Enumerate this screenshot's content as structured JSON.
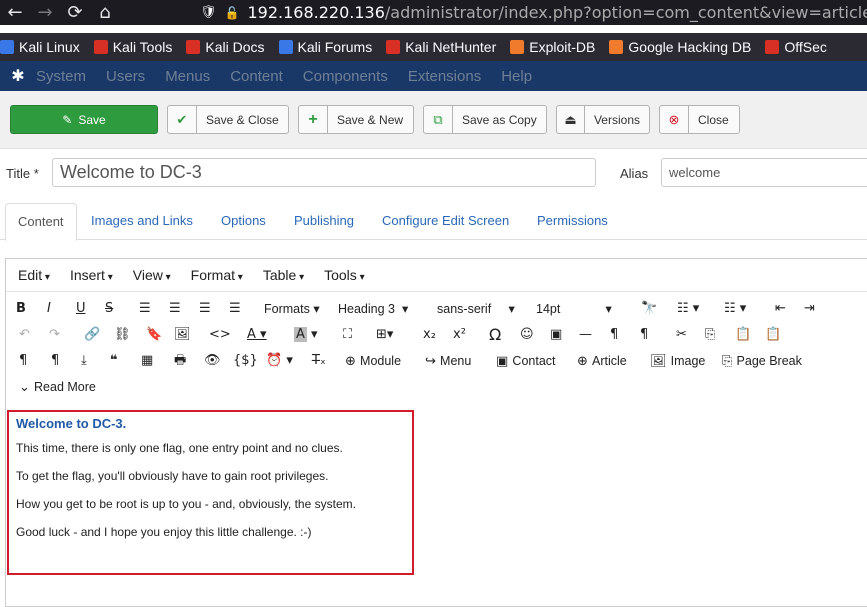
{
  "browser": {
    "nav": [
      "←",
      "→",
      "⟳",
      "⌂"
    ],
    "url_host": "192.168.220.136",
    "url_path": "/administrator/index.php?option=com_content&view=article&return=fe"
  },
  "bookmarks": [
    {
      "label": "Kali Linux",
      "color": "#3b78e7"
    },
    {
      "label": "Kali Tools",
      "color": "#d93025"
    },
    {
      "label": "Kali Docs",
      "color": "#d93025"
    },
    {
      "label": "Kali Forums",
      "color": "#3b78e7"
    },
    {
      "label": "Kali NetHunter",
      "color": "#d93025"
    },
    {
      "label": "Exploit-DB",
      "color": "#f07b2c"
    },
    {
      "label": "Google Hacking DB",
      "color": "#f07b2c"
    },
    {
      "label": "OffSec",
      "color": "#d93025"
    }
  ],
  "admin_menu": [
    "System",
    "Users",
    "Menus",
    "Content",
    "Components",
    "Extensions",
    "Help"
  ],
  "toolbar": {
    "save": "Save",
    "save_close": "Save & Close",
    "save_new": "Save & New",
    "save_copy": "Save as Copy",
    "versions": "Versions",
    "close": "Close"
  },
  "form": {
    "title_label": "Title *",
    "title_value": "Welcome to DC-3",
    "alias_label": "Alias",
    "alias_value": "welcome"
  },
  "tabs": [
    "Content",
    "Images and Links",
    "Options",
    "Publishing",
    "Configure Edit Screen",
    "Permissions"
  ],
  "editor": {
    "menus": [
      "Edit",
      "Insert",
      "View",
      "Format",
      "Table",
      "Tools"
    ],
    "formats": "Formats",
    "block": "Heading 3",
    "font": "sans-serif",
    "size": "14pt",
    "buttons": {
      "module": "Module",
      "menu": "Menu",
      "contact": "Contact",
      "article": "Article",
      "image": "Image",
      "page_break": "Page Break",
      "read_more": "Read More"
    },
    "content": {
      "heading": "Welcome to DC-3.",
      "paragraphs": [
        "This time, there is only one flag, one entry point and no clues.",
        "To get the flag, you'll obviously have to gain root privileges.",
        "How you get to be root is up to you - and, obviously, the system.",
        "Good luck - and I hope you enjoy this little challenge.  :-)"
      ]
    }
  }
}
